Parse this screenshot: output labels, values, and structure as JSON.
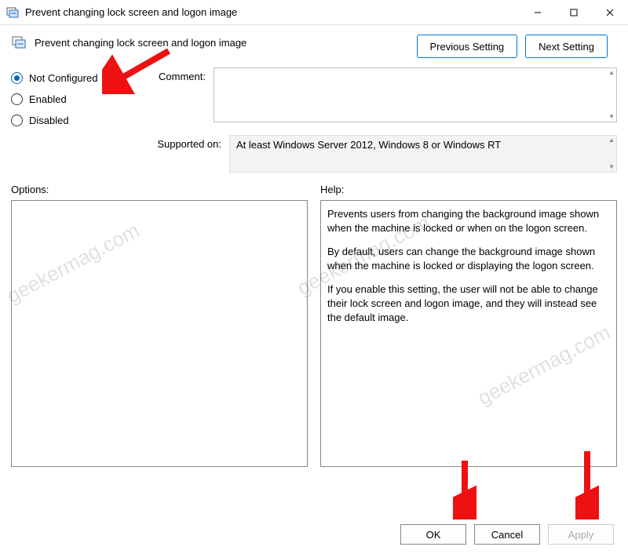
{
  "window": {
    "title": "Prevent changing lock screen and logon image"
  },
  "header": {
    "policy_title": "Prevent changing lock screen and logon image",
    "prev_btn": "Previous Setting",
    "next_btn": "Next Setting"
  },
  "state": {
    "options": [
      {
        "label": "Not Configured",
        "selected": true
      },
      {
        "label": "Enabled",
        "selected": false
      },
      {
        "label": "Disabled",
        "selected": false
      }
    ],
    "comment_label": "Comment:",
    "comment_value": "",
    "supported_label": "Supported on:",
    "supported_value": "At least Windows Server 2012, Windows 8 or Windows RT"
  },
  "panels": {
    "options_label": "Options:",
    "help_label": "Help:",
    "help_paragraphs": [
      "Prevents users from changing the background image shown when the machine is locked or when on the logon screen.",
      "By default, users can change the background image shown when the machine is locked or displaying the logon screen.",
      "If you enable this setting, the user will not be able to change their lock screen and logon image, and they will instead see the default image."
    ]
  },
  "footer": {
    "ok": "OK",
    "cancel": "Cancel",
    "apply": "Apply"
  },
  "watermark": "geekermag.com"
}
